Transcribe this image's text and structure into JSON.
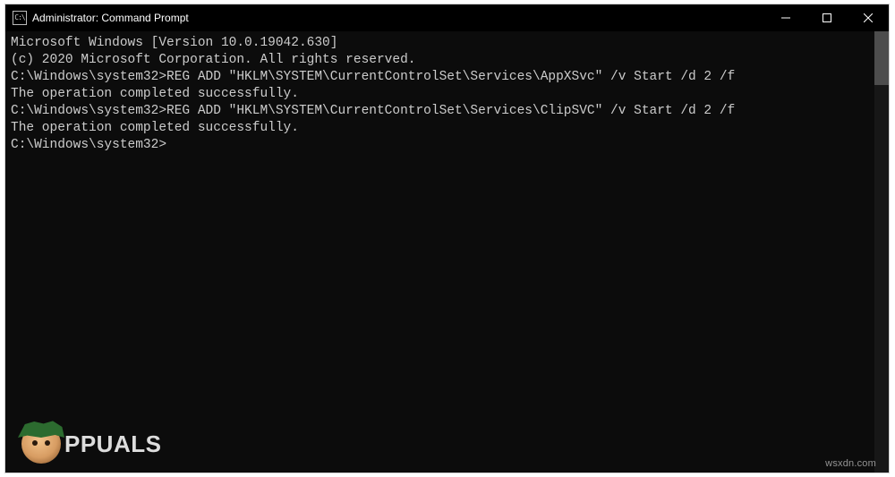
{
  "window": {
    "title": "Administrator: Command Prompt",
    "icon_label": "cmd-icon"
  },
  "terminal": {
    "lines": [
      "Microsoft Windows [Version 10.0.19042.630]",
      "(c) 2020 Microsoft Corporation. All rights reserved.",
      "",
      "C:\\Windows\\system32>REG ADD \"HKLM\\SYSTEM\\CurrentControlSet\\Services\\AppXSvc\" /v Start /d 2 /f",
      "The operation completed successfully.",
      "",
      "C:\\Windows\\system32>REG ADD \"HKLM\\SYSTEM\\CurrentControlSet\\Services\\ClipSVC\" /v Start /d 2 /f",
      "The operation completed successfully.",
      "",
      "C:\\Windows\\system32>"
    ]
  },
  "watermark": {
    "brand_text": "PPUALS",
    "url_text": "wsxdn.com"
  }
}
